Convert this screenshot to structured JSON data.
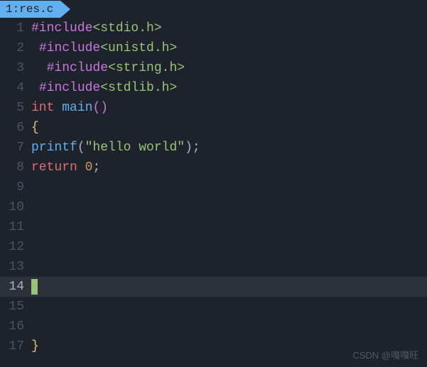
{
  "tab": {
    "index": "1",
    "filename": "res.c"
  },
  "cursor_line": 14,
  "lines": [
    {
      "n": 1,
      "indent": "",
      "tokens": [
        [
          "pre",
          "#include"
        ],
        [
          "inc",
          "<stdio.h>"
        ]
      ]
    },
    {
      "n": 2,
      "indent": " ",
      "tokens": [
        [
          "pre",
          "#include"
        ],
        [
          "inc",
          "<unistd.h>"
        ]
      ]
    },
    {
      "n": 3,
      "indent": "  ",
      "tokens": [
        [
          "pre",
          "#include"
        ],
        [
          "inc",
          "<string.h>"
        ]
      ]
    },
    {
      "n": 4,
      "indent": " ",
      "tokens": [
        [
          "pre",
          "#include"
        ],
        [
          "inc",
          "<stdlib.h>"
        ]
      ]
    },
    {
      "n": 5,
      "indent": "",
      "tokens": [
        [
          "type",
          "int"
        ],
        [
          "sp",
          " "
        ],
        [
          "func",
          "main"
        ],
        [
          "paren",
          "()"
        ]
      ]
    },
    {
      "n": 6,
      "indent": "",
      "tokens": [
        [
          "brace",
          "{"
        ]
      ]
    },
    {
      "n": 7,
      "indent": "",
      "tokens": [
        [
          "func",
          "printf"
        ],
        [
          "punc",
          "("
        ],
        [
          "str",
          "\"hello world\""
        ],
        [
          "punc",
          ");"
        ]
      ]
    },
    {
      "n": 8,
      "indent": "",
      "tokens": [
        [
          "type",
          "return"
        ],
        [
          "sp",
          " "
        ],
        [
          "num",
          "0"
        ],
        [
          "punc",
          ";"
        ]
      ]
    },
    {
      "n": 9,
      "indent": "",
      "tokens": []
    },
    {
      "n": 10,
      "indent": "",
      "tokens": []
    },
    {
      "n": 11,
      "indent": "",
      "tokens": []
    },
    {
      "n": 12,
      "indent": "",
      "tokens": []
    },
    {
      "n": 13,
      "indent": "",
      "tokens": []
    },
    {
      "n": 14,
      "indent": "",
      "tokens": []
    },
    {
      "n": 15,
      "indent": "",
      "tokens": []
    },
    {
      "n": 16,
      "indent": "",
      "tokens": []
    },
    {
      "n": 17,
      "indent": "",
      "tokens": [
        [
          "brace",
          "}"
        ]
      ]
    }
  ],
  "watermark": "CSDN @嘎嘎旺"
}
